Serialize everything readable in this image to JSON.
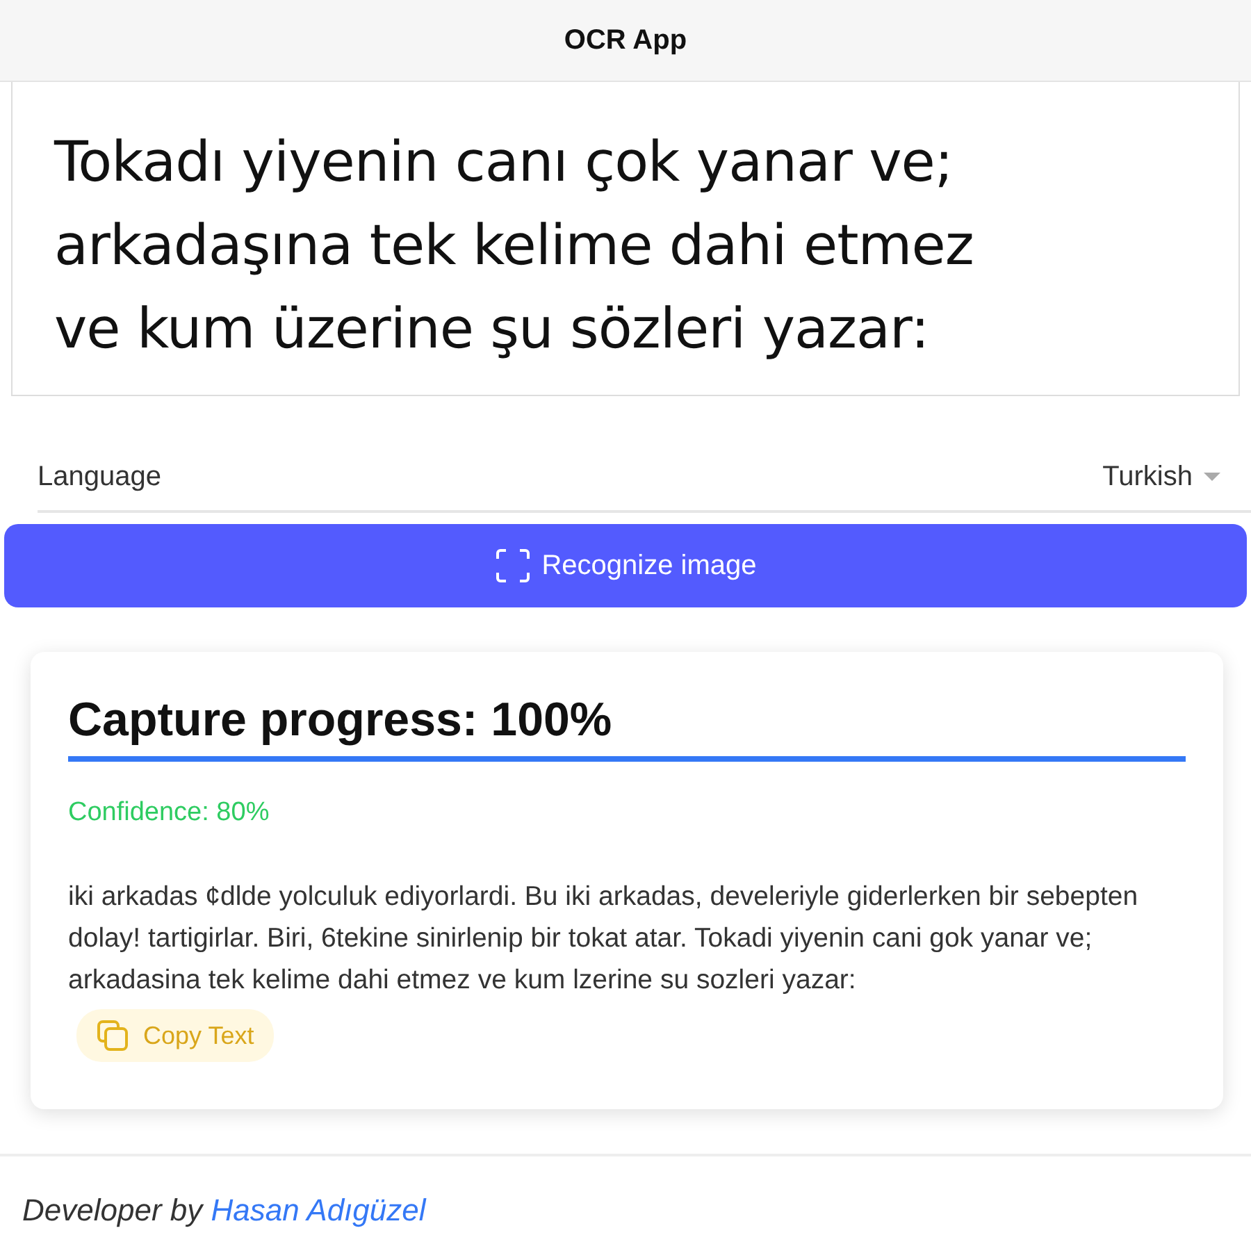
{
  "header": {
    "title": "OCR App"
  },
  "image": {
    "lines": [
      "Tokadı yiyenin canı çok yanar ve;",
      "arkadaşına tek kelime dahi etmez",
      "ve  kum üzerine şu sözleri yazar:"
    ]
  },
  "language": {
    "label": "Language",
    "value": "Turkish"
  },
  "recognize_button": {
    "label": "Recognize image"
  },
  "result": {
    "title": "Capture progress: 100%",
    "progress": {
      "level": 1
    },
    "confidence": "Confidence: 80%",
    "text": "iki arkadas ¢dlde yolculuk ediyorlardi. Bu iki arkadas, develeriyle giderlerken bir sebepten dolay! tartigirlar. Biri, 6tekine sinirlenip bir tokat atar. Tokadi yiyenin cani gok yanar ve; arkadasina tek kelime dahi etmez ve kum lzerine su sozleri yazar:",
    "copy_button": "Copy Text"
  },
  "footer": {
    "prefix": "Developer by",
    "link": "Hasan Adıgüzel"
  }
}
